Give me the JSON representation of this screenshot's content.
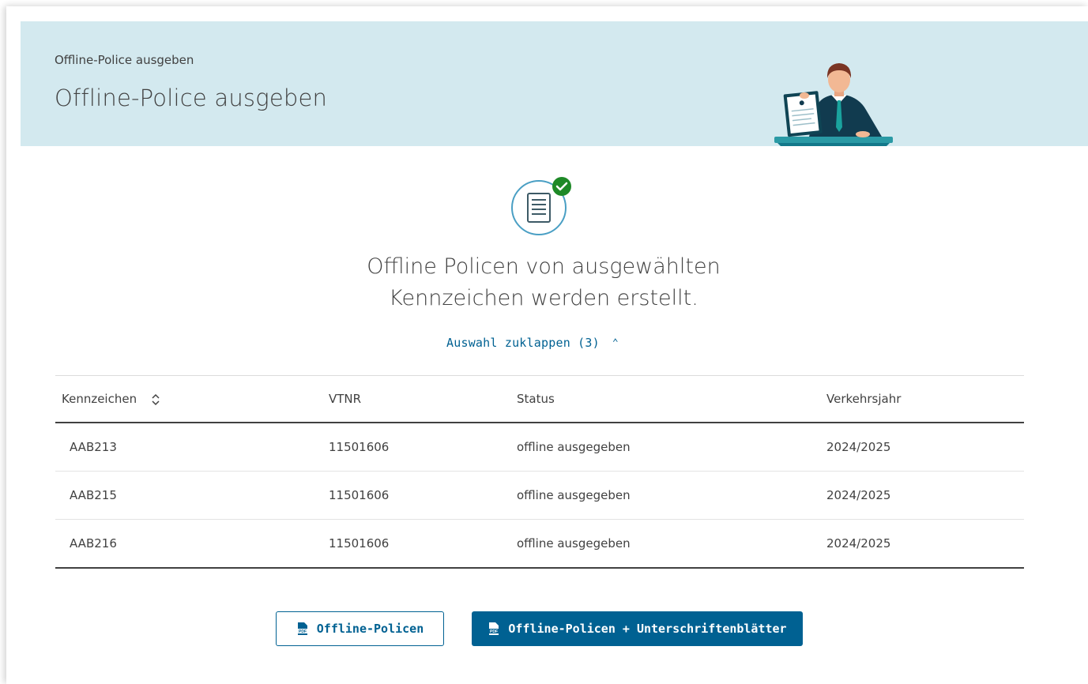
{
  "header": {
    "breadcrumb": "Offline-Police ausgeben",
    "title": "Offline-Police ausgeben"
  },
  "message": {
    "line1": "Offline Policen von ausgewählten",
    "line2": "Kennzeichen werden erstellt."
  },
  "toggle": {
    "label": "Auswahl zuklappen (3)"
  },
  "table": {
    "columns": [
      "Kennzeichen",
      "VTNR",
      "Status",
      "Verkehrsjahr"
    ],
    "rows": [
      [
        "AAB213",
        "11501606",
        "offline ausgegeben",
        "2024/2025"
      ],
      [
        "AAB215",
        "11501606",
        "offline ausgegeben",
        "2024/2025"
      ],
      [
        "AAB216",
        "11501606",
        "offline ausgegeben",
        "2024/2025"
      ]
    ]
  },
  "buttons": {
    "offline_policies": "Offline-Policen",
    "offline_policies_signatures": "Offline-Policen + Unterschriftenblätter"
  },
  "icons": {
    "sort": "sort-icon",
    "chevron": "chevron-up-icon",
    "pdf": "pdf-icon",
    "success": "check-badge-icon"
  },
  "colors": {
    "header_bg": "#d3e9ef",
    "accent": "#006192",
    "success": "#1e8927",
    "text": "#414141"
  }
}
